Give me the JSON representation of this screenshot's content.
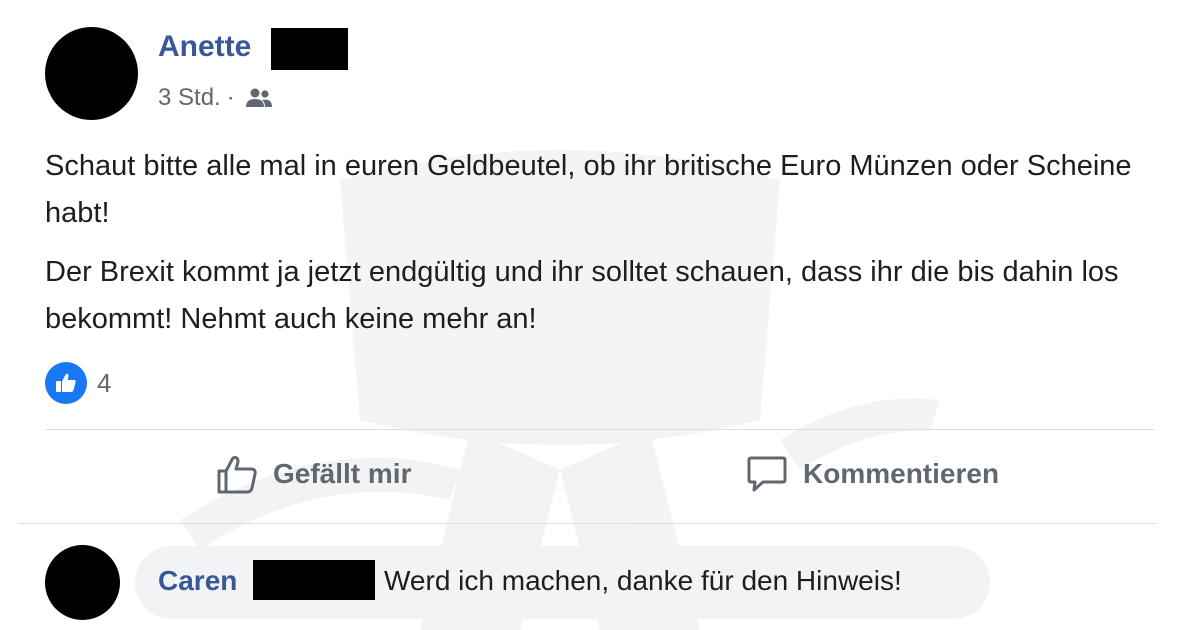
{
  "post": {
    "author": "Anette",
    "time": "3 Std.",
    "separator": "·",
    "audience_icon": "group-icon",
    "paragraphs": [
      "Schaut bitte alle mal in euren Geldbeutel, ob ihr britische Euro Münzen oder Scheine habt!",
      "Der Brexit kommt ja jetzt endgültig und ihr solltet schauen, dass ihr die bis dahin los bekommt! Nehmt auch keine mehr an!"
    ],
    "reaction_icon": "like-icon",
    "reaction_count": "4"
  },
  "actions": {
    "like_label": "Gefällt mir",
    "comment_label": "Kommentieren"
  },
  "comment": {
    "author": "Caren",
    "text": "Werd ich machen, danke für den Hinweis!"
  },
  "colors": {
    "name": "#385898",
    "like_badge": "#1877f2",
    "secondary_text": "#606770",
    "bubble": "#f2f3f5"
  }
}
